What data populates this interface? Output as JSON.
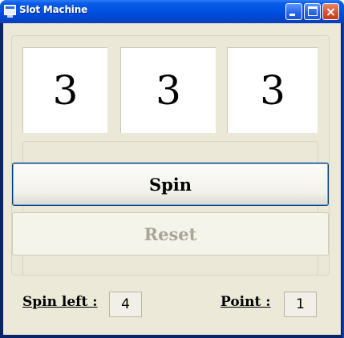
{
  "window": {
    "title": "Slot Machine",
    "icon": "app-window-icon",
    "controls": {
      "minimize": "minimize-icon",
      "maximize": "maximize-icon",
      "close": "×"
    }
  },
  "reels": [
    "3",
    "3",
    "3"
  ],
  "buttons": {
    "spin": "Spin",
    "reset": "Reset"
  },
  "status": {
    "spin_left_label": "Spin left :",
    "spin_left_value": "4",
    "point_label": "Point :",
    "point_value": "1"
  }
}
